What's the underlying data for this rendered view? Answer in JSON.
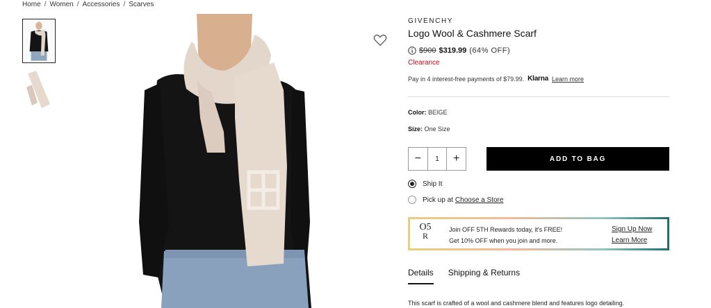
{
  "breadcrumb": [
    "Home",
    "Women",
    "Accessories",
    "Scarves"
  ],
  "breadcrumb_separator": "/",
  "product": {
    "brand": "GIVENCHY",
    "title": "Logo Wool & Cashmere Scarf",
    "original_price": "$900",
    "sale_price": "$319.99",
    "discount": "(64% OFF)",
    "status": "Clearance",
    "installment_text": "Pay in 4 interest-free payments of $79.99.",
    "installment_provider": "Klarna",
    "learn_more": "Learn more",
    "color_label": "Color:",
    "color_value": "BEIGE",
    "size_label": "Size:",
    "size_value": "One Size",
    "quantity": "1",
    "add_to_bag": "ADD TO BAG"
  },
  "fulfillment": {
    "ship_label": "Ship It",
    "pickup_label": "Pick up at",
    "pickup_link": "Choose a Store",
    "selected": "ship"
  },
  "rewards": {
    "logo_line1": "O5",
    "logo_line2": "R",
    "headline": "Join OFF 5TH Rewards today, it's FREE!",
    "subtext": "Get 10% OFF when you join and more.",
    "sign_up": "Sign Up Now",
    "learn_more": "Learn More"
  },
  "tabs": [
    {
      "label": "Details",
      "active": true
    },
    {
      "label": "Shipping & Returns",
      "active": false
    }
  ],
  "description": "This scarf is crafted of a wool and cashmere blend and features logo detailing.",
  "icons": {
    "wishlist": "heart-outline-icon",
    "price_info": "info-circle-icon"
  },
  "colors": {
    "clearance": "#d0021b",
    "button_bg": "#000000",
    "scarf": "#e3d6cb",
    "sweater": "#141414"
  }
}
